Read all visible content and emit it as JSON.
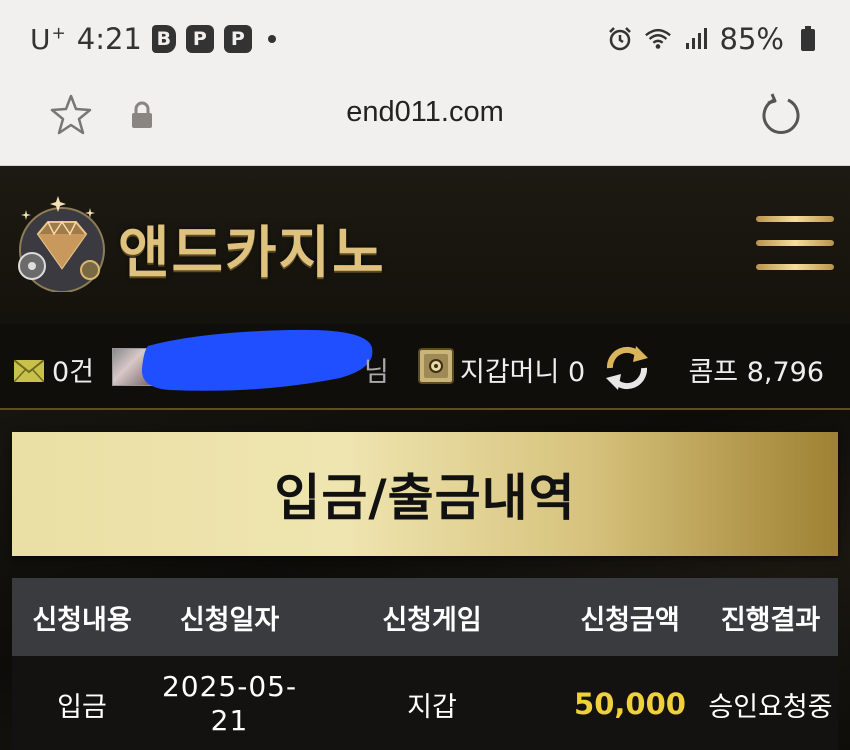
{
  "status_bar": {
    "carrier": "U",
    "carrier_sup": "+",
    "time": "4:21",
    "apps": [
      "B",
      "P",
      "P"
    ],
    "battery": "85%"
  },
  "browser": {
    "url": "end011.com"
  },
  "site": {
    "logo_text": "앤드카지노"
  },
  "user_bar": {
    "message_count": "0건",
    "username_suffix": "님",
    "wallet_label": "지갑머니 0",
    "comp_label": "콤프 8,796"
  },
  "page": {
    "title": "입금/출금내역"
  },
  "table": {
    "headers": [
      "신청내용",
      "신청일자",
      "신청게임",
      "신청금액",
      "진행결과"
    ],
    "rows": [
      {
        "type": "입금",
        "date_line1": "2025-05-",
        "date_line2": "21",
        "game": "지갑",
        "amount": "50,000",
        "result": "승인요청중"
      }
    ]
  },
  "colors": {
    "amount": "#f0d13a",
    "gold": "#dfc27e",
    "redaction": "#1f4fff"
  }
}
